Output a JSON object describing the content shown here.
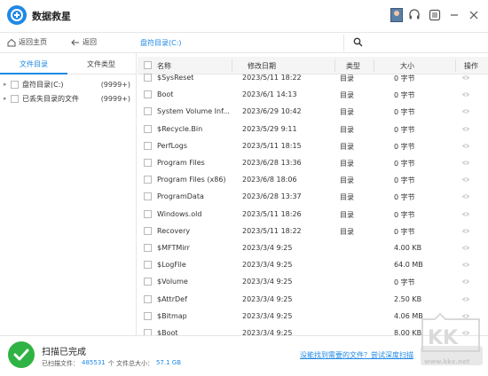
{
  "app": {
    "title": "数据救星"
  },
  "toolbar": {
    "home_label": "返回主页",
    "back_label": "返回",
    "path": "盘符目录(C:)"
  },
  "left_panel": {
    "tabs": [
      {
        "label": "文件目录",
        "active": true
      },
      {
        "label": "文件类型",
        "active": false
      }
    ],
    "tree": [
      {
        "label": "盘符目录(C:)",
        "count": "(9999+)"
      },
      {
        "label": "已丢失目录的文件",
        "count": "(9999+)"
      }
    ]
  },
  "file_list": {
    "columns": [
      "名称",
      "修改日期",
      "类型",
      "大小",
      "操作"
    ],
    "rows": [
      {
        "name": "$SysReset",
        "date": "2023/5/11 18:22",
        "type": "目录",
        "size": "0 字节"
      },
      {
        "name": "Boot",
        "date": "2023/6/1 14:13",
        "type": "目录",
        "size": "0 字节"
      },
      {
        "name": "System Volume Inf...",
        "date": "2023/6/29 10:42",
        "type": "目录",
        "size": "0 字节"
      },
      {
        "name": "$Recycle.Bin",
        "date": "2023/5/29 9:11",
        "type": "目录",
        "size": "0 字节"
      },
      {
        "name": "PerfLogs",
        "date": "2023/5/11 18:15",
        "type": "目录",
        "size": "0 字节"
      },
      {
        "name": "Program Files",
        "date": "2023/6/28 13:36",
        "type": "目录",
        "size": "0 字节"
      },
      {
        "name": "Program Files (x86)",
        "date": "2023/6/8 18:06",
        "type": "目录",
        "size": "0 字节"
      },
      {
        "name": "ProgramData",
        "date": "2023/6/28 13:37",
        "type": "目录",
        "size": "0 字节"
      },
      {
        "name": "Windows.old",
        "date": "2023/5/11 18:26",
        "type": "目录",
        "size": "0 字节"
      },
      {
        "name": "Recovery",
        "date": "2023/5/11 18:22",
        "type": "目录",
        "size": "0 字节"
      },
      {
        "name": "$MFTMirr",
        "date": "2023/3/4 9:25",
        "type": "",
        "size": "4.00 KB"
      },
      {
        "name": "$LogFile",
        "date": "2023/3/4 9:25",
        "type": "",
        "size": "64.0 MB"
      },
      {
        "name": "$Volume",
        "date": "2023/3/4 9:25",
        "type": "",
        "size": "0 字节"
      },
      {
        "name": "$AttrDef",
        "date": "2023/3/4 9:25",
        "type": "",
        "size": "2.50 KB"
      },
      {
        "name": "$Bitmap",
        "date": "2023/3/4 9:25",
        "type": "",
        "size": "4.06 MB"
      },
      {
        "name": "$Boot",
        "date": "2023/3/4 9:25",
        "type": "",
        "size": "8.00 KB"
      }
    ]
  },
  "status": {
    "title": "扫描已完成",
    "scanned_label": "已扫描文件：",
    "scanned_count": "485531",
    "size_label": "个 文件总大小：",
    "size_value": "57.1 GB",
    "help_link": "没能找到需要的文件？尝试深度扫描"
  },
  "watermark": {
    "text": "www.kkx.net"
  },
  "colors": {
    "accent": "#1e88e5",
    "success": "#2fb344"
  }
}
